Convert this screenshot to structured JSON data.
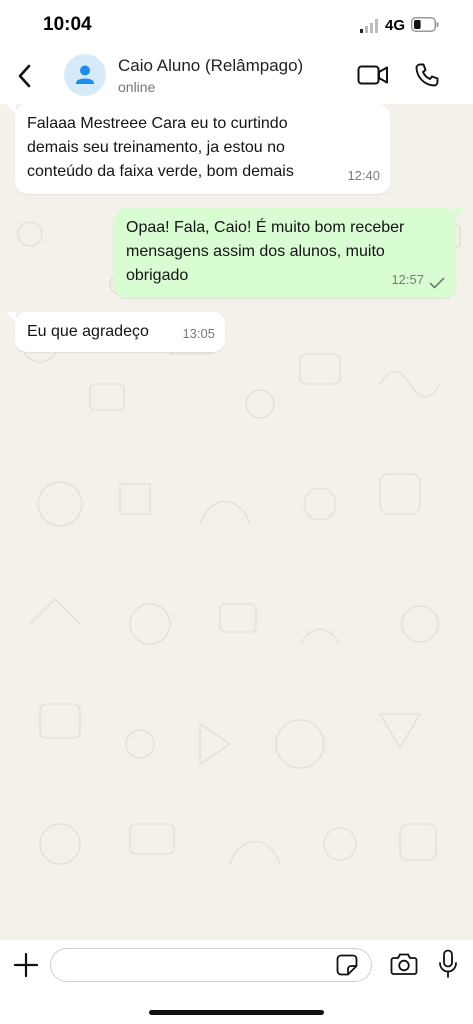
{
  "status_bar": {
    "time": "10:04",
    "network": "4G",
    "battery_level": 0.35
  },
  "header": {
    "back_icon": "chevron-left-icon",
    "avatar_icon": "person-icon",
    "contact_name": "Caio Aluno (Relâmpago)",
    "contact_status": "online",
    "video_call_icon": "video-camera-icon",
    "voice_call_icon": "phone-icon"
  },
  "messages": [
    {
      "direction": "incoming",
      "lines": [
        "Falaaa Mestreee Cara eu to curtindo",
        "demais seu treinamento, ja estou no",
        "conteúdo da faixa verde, bom demais"
      ],
      "time": "12:40"
    },
    {
      "direction": "outgoing",
      "lines": [
        "Opaa! Fala, Caio! É muito bom receber",
        "mensagens assim dos alunos, muito",
        "obrigado"
      ],
      "time": "12:57",
      "status_icon": "check-icon"
    },
    {
      "direction": "incoming",
      "lines": [
        "Eu que agradeço"
      ],
      "time": "13:05"
    }
  ],
  "input_bar": {
    "attach_icon": "plus-icon",
    "placeholder": "",
    "value": "",
    "sticker_icon": "sticker-icon",
    "camera_icon": "camera-icon",
    "mic_icon": "microphone-icon"
  },
  "colors": {
    "incoming_bubble": "#ffffff",
    "outgoing_bubble": "#d9fdd3",
    "chat_background": "#f4f1ea",
    "avatar_background": "#d6ebf9",
    "avatar_icon": "#1d8ef0"
  }
}
